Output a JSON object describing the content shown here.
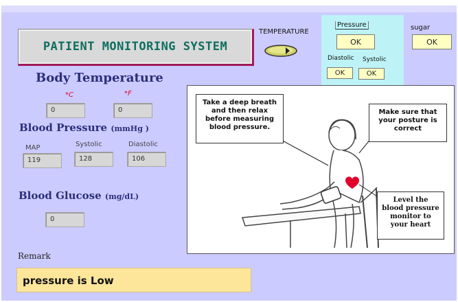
{
  "header": {
    "title": "PATIENT MONITORING SYSTEM",
    "temperature_label": "TEMPERATURE",
    "pressure_label": "Pressure",
    "sugar_label": "sugar",
    "diastolic_label": "Diastolic",
    "systolic_label": "Systolic",
    "ok_label": "OK"
  },
  "body_temperature": {
    "heading": "Body Temperature",
    "celsius_unit": "*C",
    "fahrenheit_unit": "*F",
    "celsius_value": "0",
    "fahrenheit_value": "0"
  },
  "blood_pressure": {
    "heading": "Blood Pressure",
    "unit": "(mmHg )",
    "map_label": "MAP",
    "systolic_label": "Systolic",
    "diastolic_label": "Diastolic",
    "map_value": "119",
    "systolic_value": "128",
    "diastolic_value": "106"
  },
  "blood_glucose": {
    "heading": "Blood Glucose",
    "unit": "(mg/dL)",
    "value": "0"
  },
  "remark": {
    "label": "Remark",
    "text": "pressure is Low"
  },
  "illustration": {
    "callout_breath": "Take a deep breath and then relax before measuring blood pressure.",
    "callout_posture": "Make sure that your posture is correct",
    "callout_level": "Level the blood pressure monitor to your heart"
  },
  "colors": {
    "panel_bg": "#cccbff",
    "title_text": "#0d6e5e",
    "heading_text": "#2b2f7a",
    "unit_red": "#e0002a",
    "ok_button_bg": "#ffffc4",
    "pressure_panel_bg": "#bdf3f6",
    "remark_bg": "#fde59a"
  },
  "icons": {
    "temperature_toggle": "toggle-switch-icon",
    "heart": "heart-icon"
  }
}
